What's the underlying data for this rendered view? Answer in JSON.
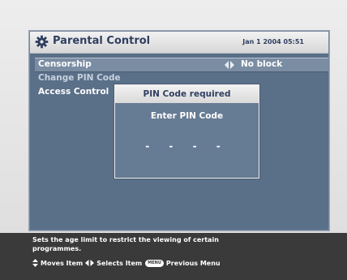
{
  "window": {
    "title": "Parental Control",
    "date": "Jan 1 2004 05:51",
    "title_icon": "gear-icon"
  },
  "menu": {
    "items": [
      {
        "label": "Censorship",
        "value": "No block",
        "selected": true
      },
      {
        "label": "Change PIN Code"
      },
      {
        "label": "Access Control"
      }
    ]
  },
  "dialog": {
    "title": "PIN Code required",
    "prompt": "Enter PIN Code",
    "pin_mask": "- - - -"
  },
  "help": {
    "line1": "Sets the age limit to restrict the viewing of certain",
    "line2": "programmes.",
    "moves": "Moves Item",
    "selects": "Selects Item",
    "menu_key": "MENU",
    "previous": "Previous Menu"
  },
  "colors": {
    "window_bg": "#5a6f88",
    "selected_row": "#7b8da3",
    "title_text": "#2f3f60",
    "help_bar": "#3a3a3a"
  }
}
